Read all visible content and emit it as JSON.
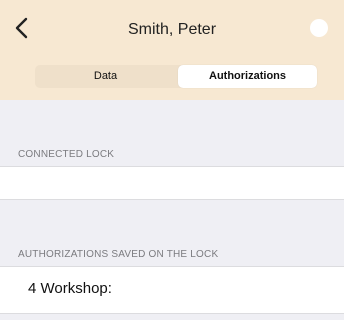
{
  "navbar": {
    "title": "Smith, Peter",
    "back_icon": "chevron-left-icon",
    "right_icon": "circle-icon"
  },
  "segmented": {
    "tabs": [
      {
        "label": "Data",
        "selected": false
      },
      {
        "label": "Authorizations",
        "selected": true
      }
    ]
  },
  "sections": {
    "connected_lock": {
      "header": "CONNECTED LOCK"
    },
    "saved_authorizations": {
      "header": "AUTHORIZATIONS SAVED ON THE LOCK",
      "items": [
        {
          "label": "4 Workshop:"
        }
      ]
    }
  },
  "colors": {
    "nav_background": "#f7e8d2",
    "page_background": "#efeff4",
    "segment_selected": "#ffffff"
  }
}
